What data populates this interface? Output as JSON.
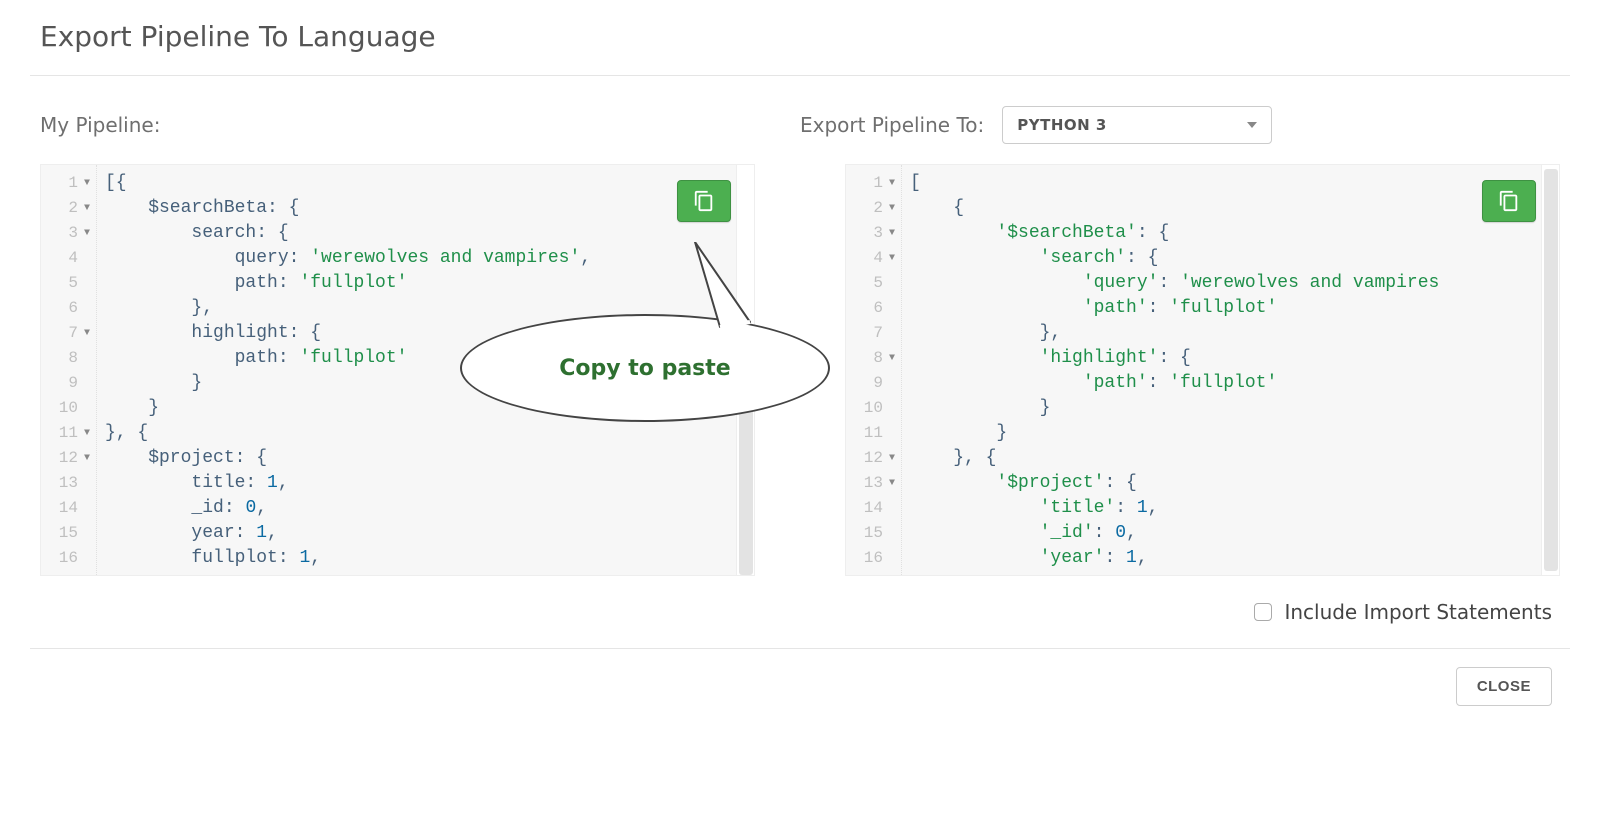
{
  "dialog": {
    "title": "Export Pipeline To Language",
    "close_label": "CLOSE"
  },
  "left": {
    "label": "My Pipeline:",
    "lines": [
      {
        "num": "1",
        "fold": true,
        "html": "[{"
      },
      {
        "num": "2",
        "fold": true,
        "html": "    $searchBeta: {"
      },
      {
        "num": "3",
        "fold": true,
        "html": "        search: {"
      },
      {
        "num": "4",
        "fold": false,
        "html": "            query: <span class='s'>'werewolves and vampires'</span>,"
      },
      {
        "num": "5",
        "fold": false,
        "html": "            path: <span class='s'>'fullplot'</span>"
      },
      {
        "num": "6",
        "fold": false,
        "html": "        },"
      },
      {
        "num": "7",
        "fold": true,
        "html": "        highlight: {"
      },
      {
        "num": "8",
        "fold": false,
        "html": "            path: <span class='s'>'fullplot'</span>"
      },
      {
        "num": "9",
        "fold": false,
        "html": "        }"
      },
      {
        "num": "10",
        "fold": false,
        "html": "    }"
      },
      {
        "num": "11",
        "fold": true,
        "html": "}, {"
      },
      {
        "num": "12",
        "fold": true,
        "html": "    $project: {"
      },
      {
        "num": "13",
        "fold": false,
        "html": "        title: <span class='n'>1</span>,"
      },
      {
        "num": "14",
        "fold": false,
        "html": "        _id: <span class='n'>0</span>,"
      },
      {
        "num": "15",
        "fold": false,
        "html": "        year: <span class='n'>1</span>,"
      },
      {
        "num": "16",
        "fold": false,
        "html": "        fullplot: <span class='n'>1</span>,"
      }
    ]
  },
  "right": {
    "label": "Export Pipeline To:",
    "select_value": "PYTHON 3",
    "lines": [
      {
        "num": "1",
        "fold": true,
        "html": "["
      },
      {
        "num": "2",
        "fold": true,
        "html": "    {"
      },
      {
        "num": "3",
        "fold": true,
        "html": "        <span class='s'>'$searchBeta'</span>: {"
      },
      {
        "num": "4",
        "fold": true,
        "html": "            <span class='s'>'search'</span>: {"
      },
      {
        "num": "5",
        "fold": false,
        "html": "                <span class='s'>'query'</span>: <span class='s'>'werewolves and vampires</span>"
      },
      {
        "num": "6",
        "fold": false,
        "html": "                <span class='s'>'path'</span>: <span class='s'>'fullplot'</span>"
      },
      {
        "num": "7",
        "fold": false,
        "html": "            },"
      },
      {
        "num": "8",
        "fold": true,
        "html": "            <span class='s'>'highlight'</span>: {"
      },
      {
        "num": "9",
        "fold": false,
        "html": "                <span class='s'>'path'</span>: <span class='s'>'fullplot'</span>"
      },
      {
        "num": "10",
        "fold": false,
        "html": "            }"
      },
      {
        "num": "11",
        "fold": false,
        "html": "        }"
      },
      {
        "num": "12",
        "fold": true,
        "html": "    }, {"
      },
      {
        "num": "13",
        "fold": true,
        "html": "        <span class='s'>'$project'</span>: {"
      },
      {
        "num": "14",
        "fold": false,
        "html": "            <span class='s'>'title'</span>: <span class='n'>1</span>,"
      },
      {
        "num": "15",
        "fold": false,
        "html": "            <span class='s'>'_id'</span>: <span class='n'>0</span>,"
      },
      {
        "num": "16",
        "fold": false,
        "html": "            <span class='s'>'year'</span>: <span class='n'>1</span>,"
      }
    ]
  },
  "callout": {
    "text": "Copy to paste"
  },
  "options": {
    "include_imports_label": "Include Import Statements",
    "include_imports_checked": false
  },
  "colors": {
    "copy_button": "#4caf50",
    "string": "#1f8f4a",
    "number": "#0b6aa2"
  }
}
